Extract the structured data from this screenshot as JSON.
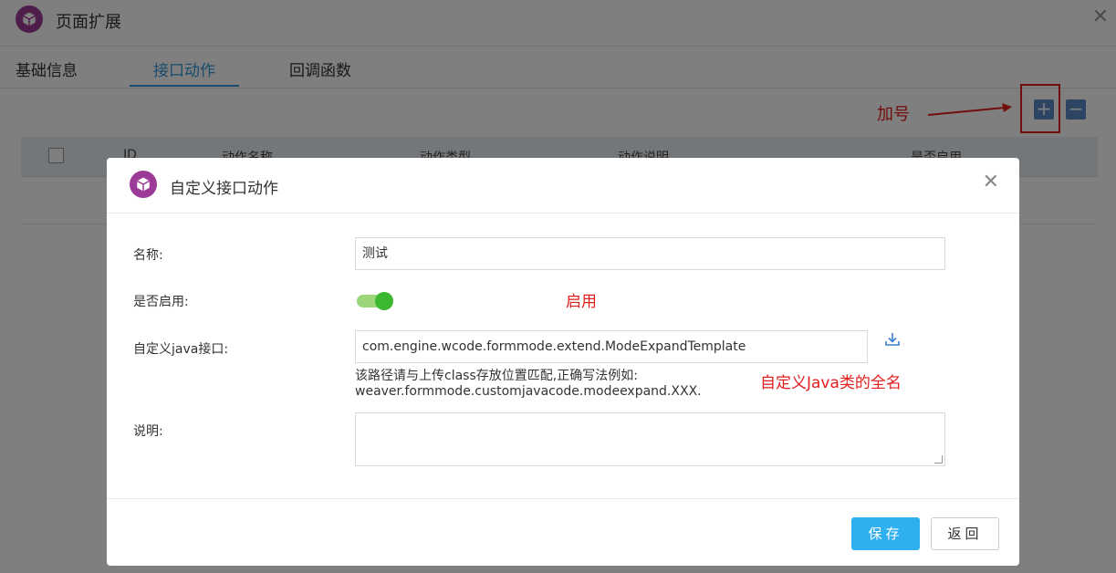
{
  "page": {
    "title": "页面扩展",
    "close_icon": "close-icon",
    "tabs": [
      {
        "label": "基础信息"
      },
      {
        "label": "接口动作"
      },
      {
        "label": "回调函数"
      }
    ],
    "active_tab": "接口动作",
    "toolbar": {
      "annotation": "加号",
      "add_icon": "plus-icon",
      "remove_icon": "minus-icon"
    },
    "table": {
      "columns": [
        "ID",
        "动作名称",
        "动作类型",
        "动作说明",
        "是否启用"
      ]
    }
  },
  "modal": {
    "title": "自定义接口动作",
    "fields": {
      "name_label": "名称:",
      "name_value": "测试",
      "enabled_label": "是否启用:",
      "enabled": true,
      "enabled_note": "启用",
      "java_label": "自定义java接口:",
      "java_value": "com.engine.wcode.formmode.extend.ModeExpandTemplate",
      "java_hint_line1": "该路径请与上传class存放位置匹配,正确写法例如:",
      "java_hint_line2": "weaver.formmode.customjavacode.modeexpand.XXX.",
      "java_note": "自定义Java类的全名",
      "desc_label": "说明:",
      "desc_value": ""
    },
    "buttons": {
      "save": "保存",
      "back": "返回"
    }
  },
  "colors": {
    "accent": "#3498db",
    "logo": "#9c3b97",
    "save_button": "#2eaff0",
    "annotation_red": "#e31c1c",
    "toggle_on": "#3cb830"
  }
}
